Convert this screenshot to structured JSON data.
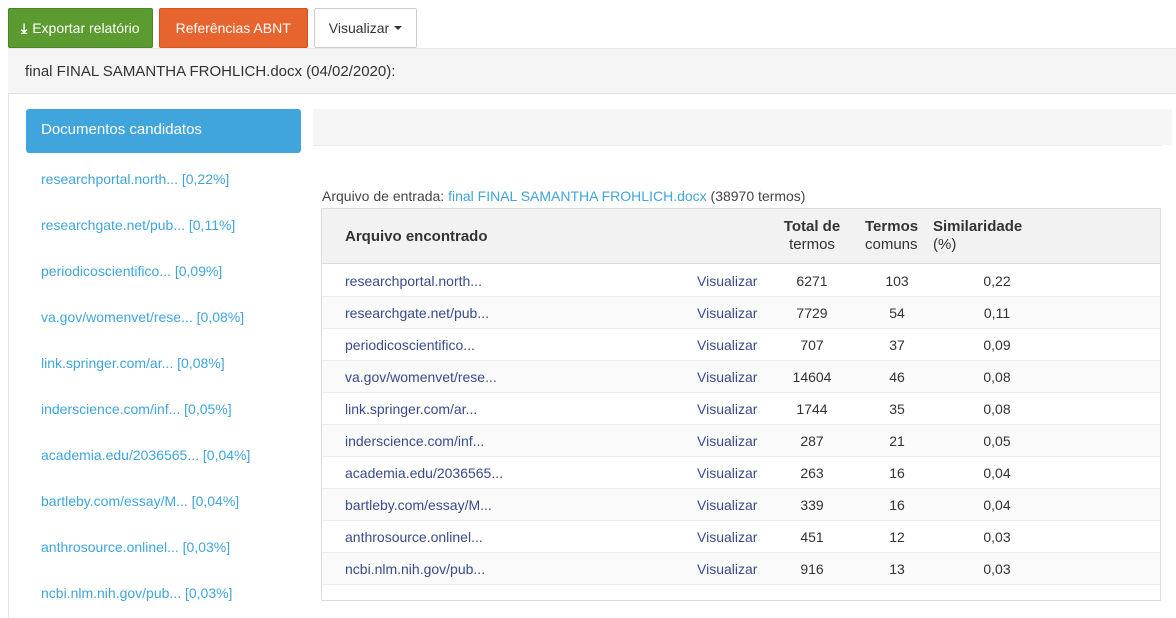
{
  "toolbar": {
    "export_label": "Exportar relatório",
    "abnt_label": "Referências ABNT",
    "view_label": "Visualizar"
  },
  "file_header": "final FINAL SAMANTHA FROHLICH.docx (04/02/2020):",
  "sidebar": {
    "active_label": "Documentos candidatos",
    "items": [
      {
        "label": "researchportal.north... [0,22%]"
      },
      {
        "label": "researchgate.net/pub... [0,11%]"
      },
      {
        "label": "periodicoscientifico... [0,09%]"
      },
      {
        "label": "va.gov/womenvet/rese... [0,08%]"
      },
      {
        "label": "link.springer.com/ar... [0,08%]"
      },
      {
        "label": "inderscience.com/inf... [0,05%]"
      },
      {
        "label": "academia.edu/2036565... [0,04%]"
      },
      {
        "label": "bartleby.com/essay/M... [0,04%]"
      },
      {
        "label": "anthrosource.onlinel... [0,03%]"
      },
      {
        "label": "ncbi.nlm.nih.gov/pub... [0,03%]"
      }
    ]
  },
  "entrada": {
    "prefix": "Arquivo de entrada: ",
    "file": "final FINAL SAMANTHA FROHLICH.docx",
    "suffix": " (38970 termos)"
  },
  "table": {
    "headers": {
      "file": "Arquivo encontrado",
      "total_line1": "Total de",
      "total_line2": "termos",
      "comuns_line1": "Termos",
      "comuns_line2": "comuns",
      "sim_line1": "Similaridade",
      "sim_line2": "(%)"
    },
    "view_label": "Visualizar",
    "rows": [
      {
        "name": "researchportal.north...",
        "total": "6271",
        "comuns": "103",
        "sim": "0,22"
      },
      {
        "name": "researchgate.net/pub...",
        "total": "7729",
        "comuns": "54",
        "sim": "0,11"
      },
      {
        "name": "periodicoscientifico...",
        "total": "707",
        "comuns": "37",
        "sim": "0,09"
      },
      {
        "name": "va.gov/womenvet/rese...",
        "total": "14604",
        "comuns": "46",
        "sim": "0,08"
      },
      {
        "name": "link.springer.com/ar...",
        "total": "1744",
        "comuns": "35",
        "sim": "0,08"
      },
      {
        "name": "inderscience.com/inf...",
        "total": "287",
        "comuns": "21",
        "sim": "0,05"
      },
      {
        "name": "academia.edu/2036565...",
        "total": "263",
        "comuns": "16",
        "sim": "0,04"
      },
      {
        "name": "bartleby.com/essay/M...",
        "total": "339",
        "comuns": "16",
        "sim": "0,04"
      },
      {
        "name": "anthrosource.onlinel...",
        "total": "451",
        "comuns": "12",
        "sim": "0,03"
      },
      {
        "name": "ncbi.nlm.nih.gov/pub...",
        "total": "916",
        "comuns": "13",
        "sim": "0,03"
      }
    ]
  }
}
